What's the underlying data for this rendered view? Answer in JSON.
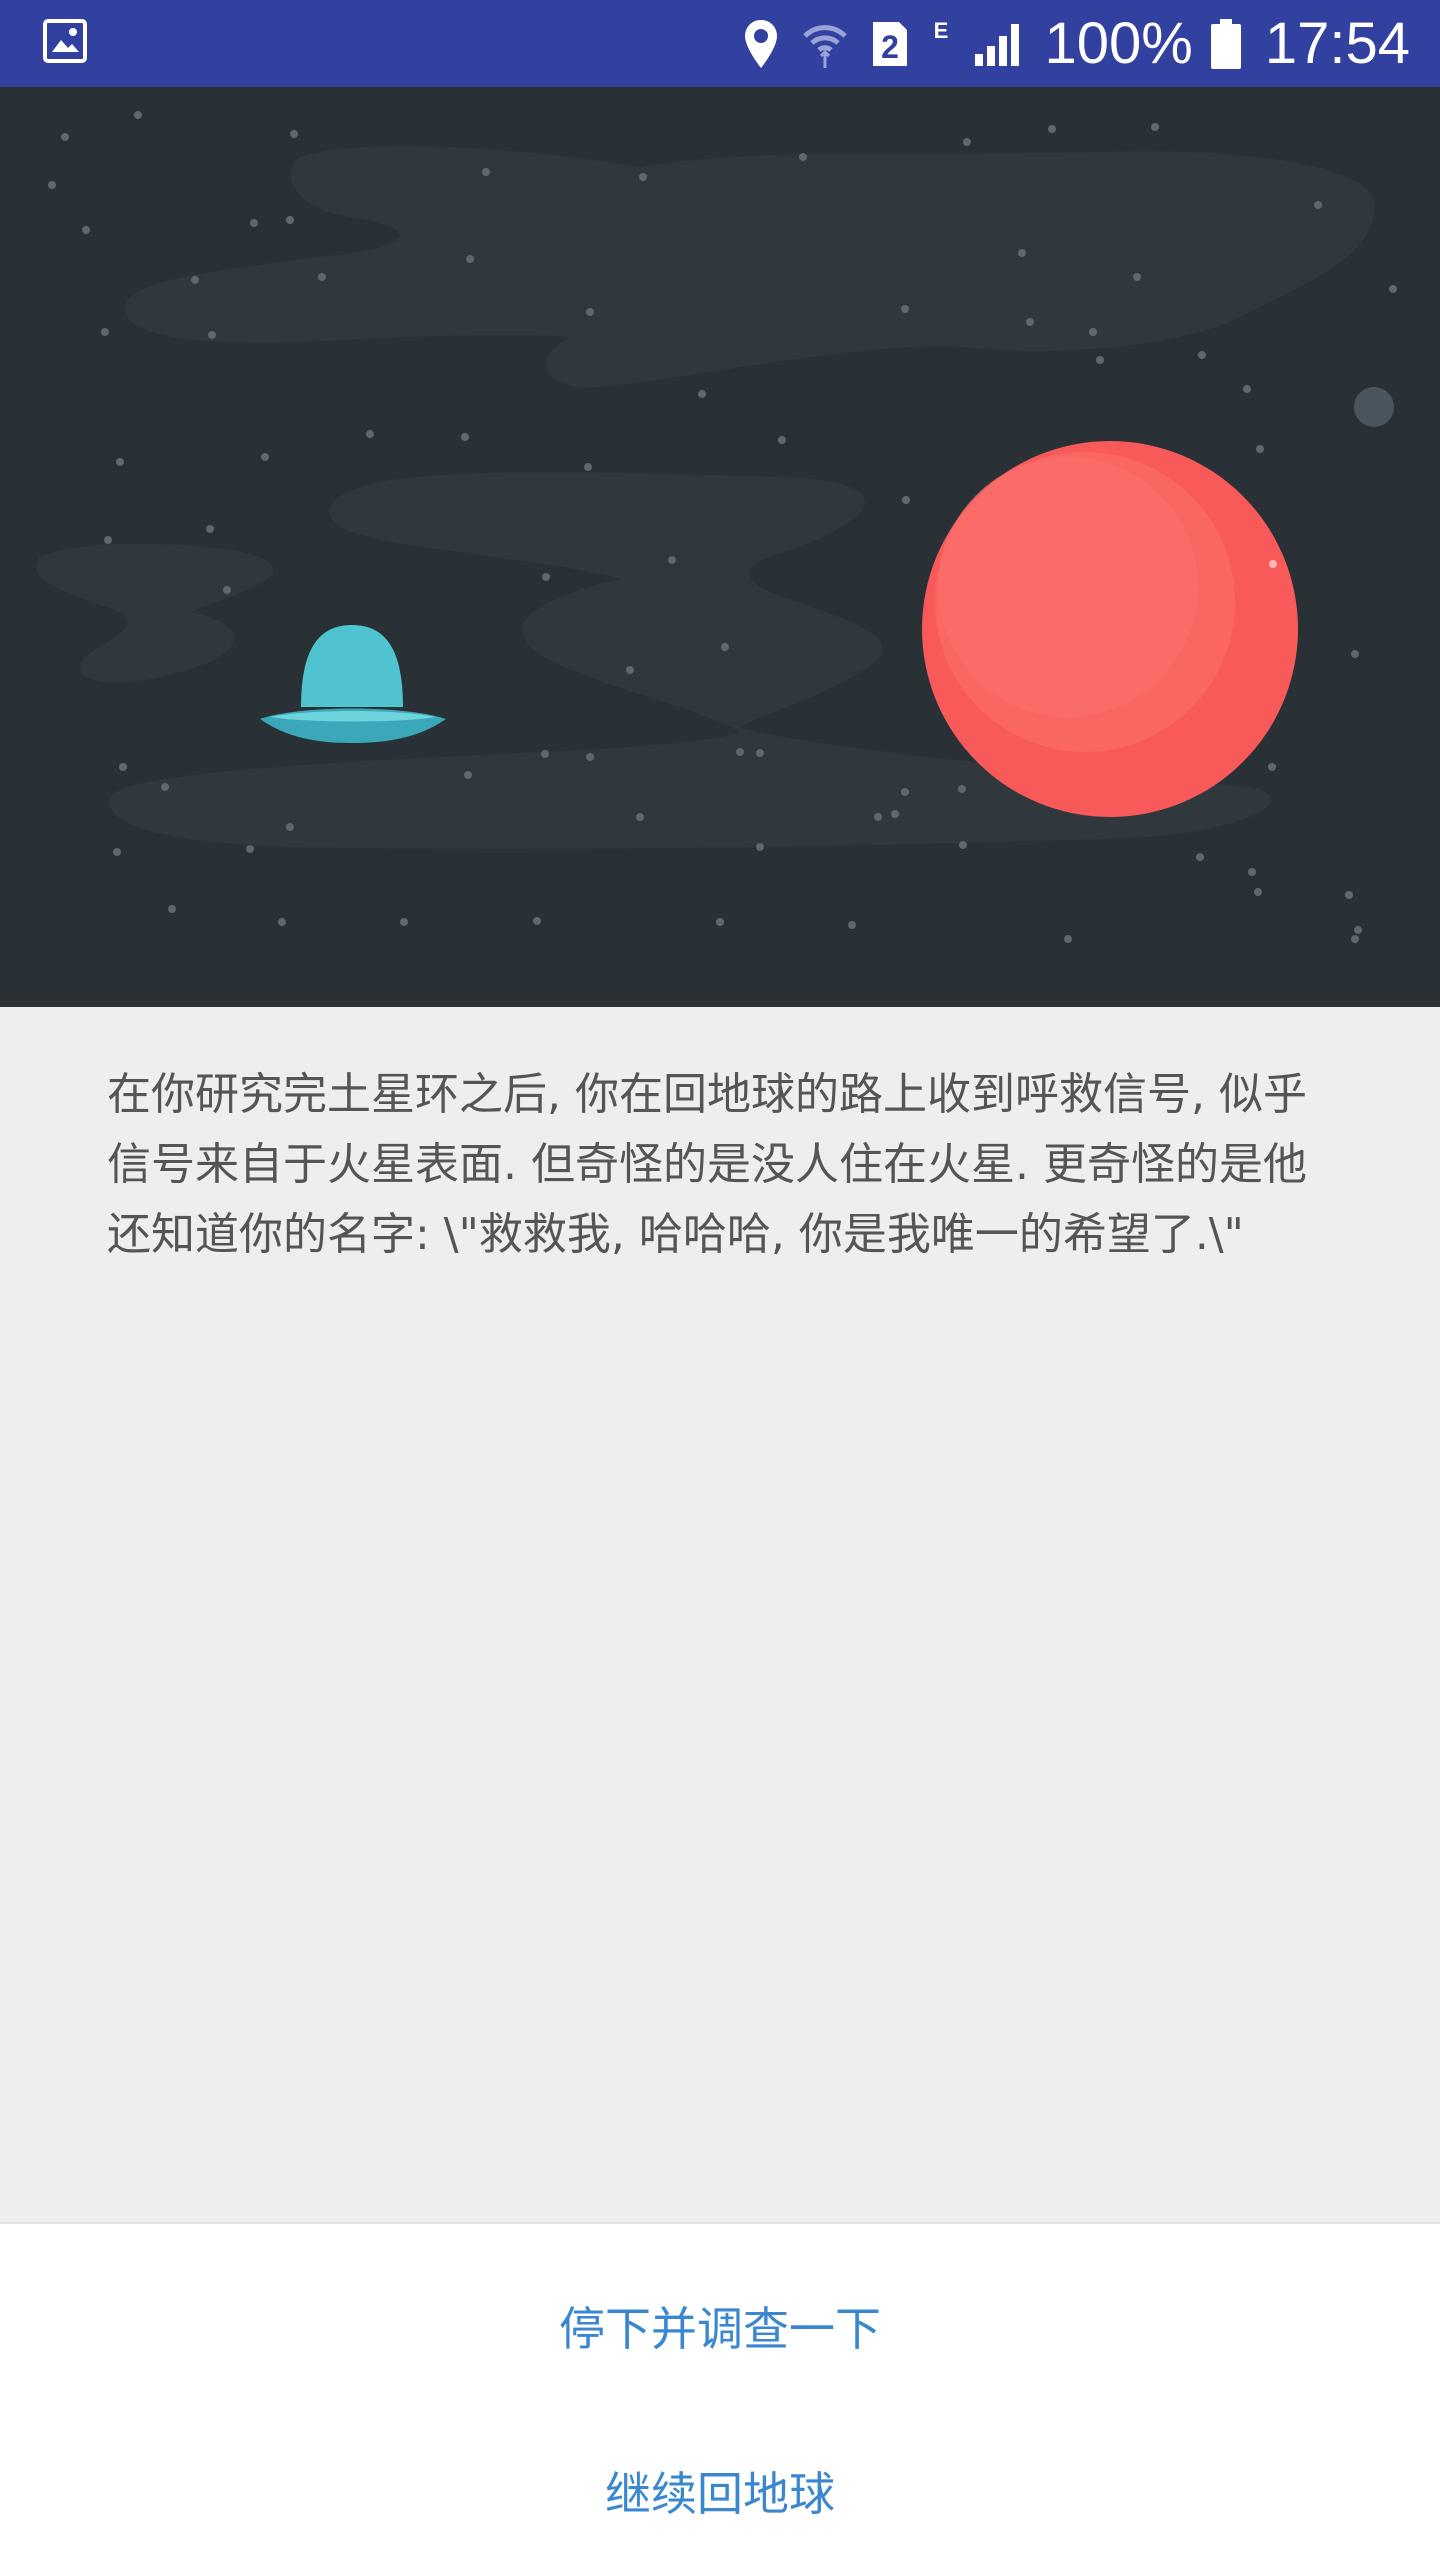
{
  "status_bar": {
    "battery_percent": "100%",
    "time": "17:54",
    "sim_badge": "2",
    "network_type": "E",
    "icons": [
      "gallery-icon",
      "location-icon",
      "wifi-icon",
      "sim-2-icon",
      "network-e-icon",
      "signal-icon",
      "battery-icon"
    ],
    "background": "#3240a0"
  },
  "hero": {
    "background": "#293036",
    "planet_color": "#f75a58",
    "ufo_color": "#4fc3cf"
  },
  "story": {
    "text": "在你研究完土星环之后, 你在回地球的路上收到呼救信号, 似乎信号来自于火星表面. 但奇怪的是没人住在火星. 更奇怪的是他还知道你的名字: \\\"救救我, 哈哈哈, 你是我唯一的希望了.\\\""
  },
  "choices": {
    "option_1": "停下并调查一下",
    "option_2": "继续回地球",
    "color": "#3a87d0"
  }
}
